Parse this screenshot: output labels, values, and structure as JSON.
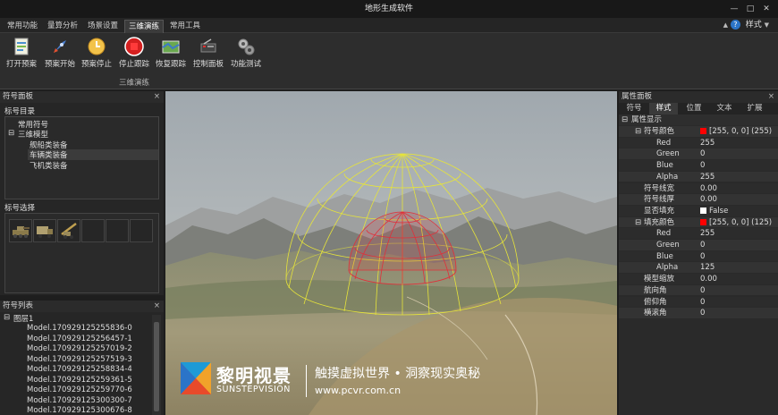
{
  "app": {
    "title": "地形生成软件"
  },
  "menu_tabs": [
    {
      "label": "常用功能"
    },
    {
      "label": "量算分析"
    },
    {
      "label": "场景设置"
    },
    {
      "label": "三维演练"
    },
    {
      "label": "常用工具"
    }
  ],
  "help": {
    "style_label": "样式"
  },
  "ribbon": {
    "group": "三维演练",
    "buttons": [
      {
        "label": "打开预案",
        "icon": "document-icon"
      },
      {
        "label": "预案开始",
        "icon": "rocket-icon"
      },
      {
        "label": "预案停止",
        "icon": "stop-clock-icon"
      },
      {
        "label": "停止跟踪",
        "icon": "stop-icon"
      },
      {
        "label": "恢复跟踪",
        "icon": "map-icon"
      },
      {
        "label": "控制面板",
        "icon": "control-panel-icon"
      },
      {
        "label": "功能测试",
        "icon": "gears-icon"
      }
    ]
  },
  "symbol_panel": {
    "title": "符号面板",
    "catalog_title": "标号目录",
    "tree": [
      {
        "label": "常用符号"
      },
      {
        "label": "三维模型",
        "toggle": "⊟"
      },
      {
        "label": "舰船类装备"
      },
      {
        "label": "车辆类装备"
      },
      {
        "label": "飞机类装备"
      }
    ],
    "select_title": "标号选择"
  },
  "symbol_list": {
    "title": "符号列表",
    "layer": "图层1",
    "toggle": "⊟",
    "items": [
      "Model.170929125255836-0",
      "Model.170929125256457-1",
      "Model.170929125257019-2",
      "Model.170929125257519-3",
      "Model.170929125258834-4",
      "Model.170929125259361-5",
      "Model.170929125259770-6",
      "Model.170929125300300-7",
      "Model.170929125300676-8"
    ]
  },
  "watermark": {
    "brand_cn": "黎明视景",
    "brand_en": "SUNSTEPVISION",
    "slogan": "触摸虚拟世界 • 洞察现实奥秘",
    "url": "www.pcvr.com.cn"
  },
  "property_panel": {
    "title": "属性面板",
    "tabs": [
      "符号",
      "样式",
      "位置",
      "文本",
      "扩展"
    ],
    "active_tab": "样式",
    "section": "属性显示",
    "rows": [
      {
        "key": "符号颜色",
        "value": "[255, 0, 0] (255)",
        "swatch": "#ff0000",
        "toggle": "⊟",
        "level": 1
      },
      {
        "key": "Red",
        "value": "255",
        "level": 2
      },
      {
        "key": "Green",
        "value": "0",
        "level": 2
      },
      {
        "key": "Blue",
        "value": "0",
        "level": 2
      },
      {
        "key": "Alpha",
        "value": "255",
        "level": 2
      },
      {
        "key": "符号线宽",
        "value": "0.00",
        "level": 1
      },
      {
        "key": "符号线厚",
        "value": "0.00",
        "level": 1
      },
      {
        "key": "显否填充",
        "value": "False",
        "check": true,
        "level": 1
      },
      {
        "key": "填充颜色",
        "value": "[255, 0, 0] (125)",
        "swatch": "#ff0000",
        "toggle": "⊟",
        "level": 1
      },
      {
        "key": "Red",
        "value": "255",
        "level": 2
      },
      {
        "key": "Green",
        "value": "0",
        "level": 2
      },
      {
        "key": "Blue",
        "value": "0",
        "level": 2
      },
      {
        "key": "Alpha",
        "value": "125",
        "level": 2
      },
      {
        "key": "模型缩放",
        "value": "0.00",
        "level": 1
      },
      {
        "key": "航向角",
        "value": "0",
        "level": 1
      },
      {
        "key": "俯仰角",
        "value": "0",
        "level": 1
      },
      {
        "key": "横滚角",
        "value": "0",
        "level": 1
      }
    ]
  },
  "colors": {
    "accent": "#2b74c8",
    "outer_dome": "#e6e43a",
    "inner_dome": "#e0303a"
  }
}
